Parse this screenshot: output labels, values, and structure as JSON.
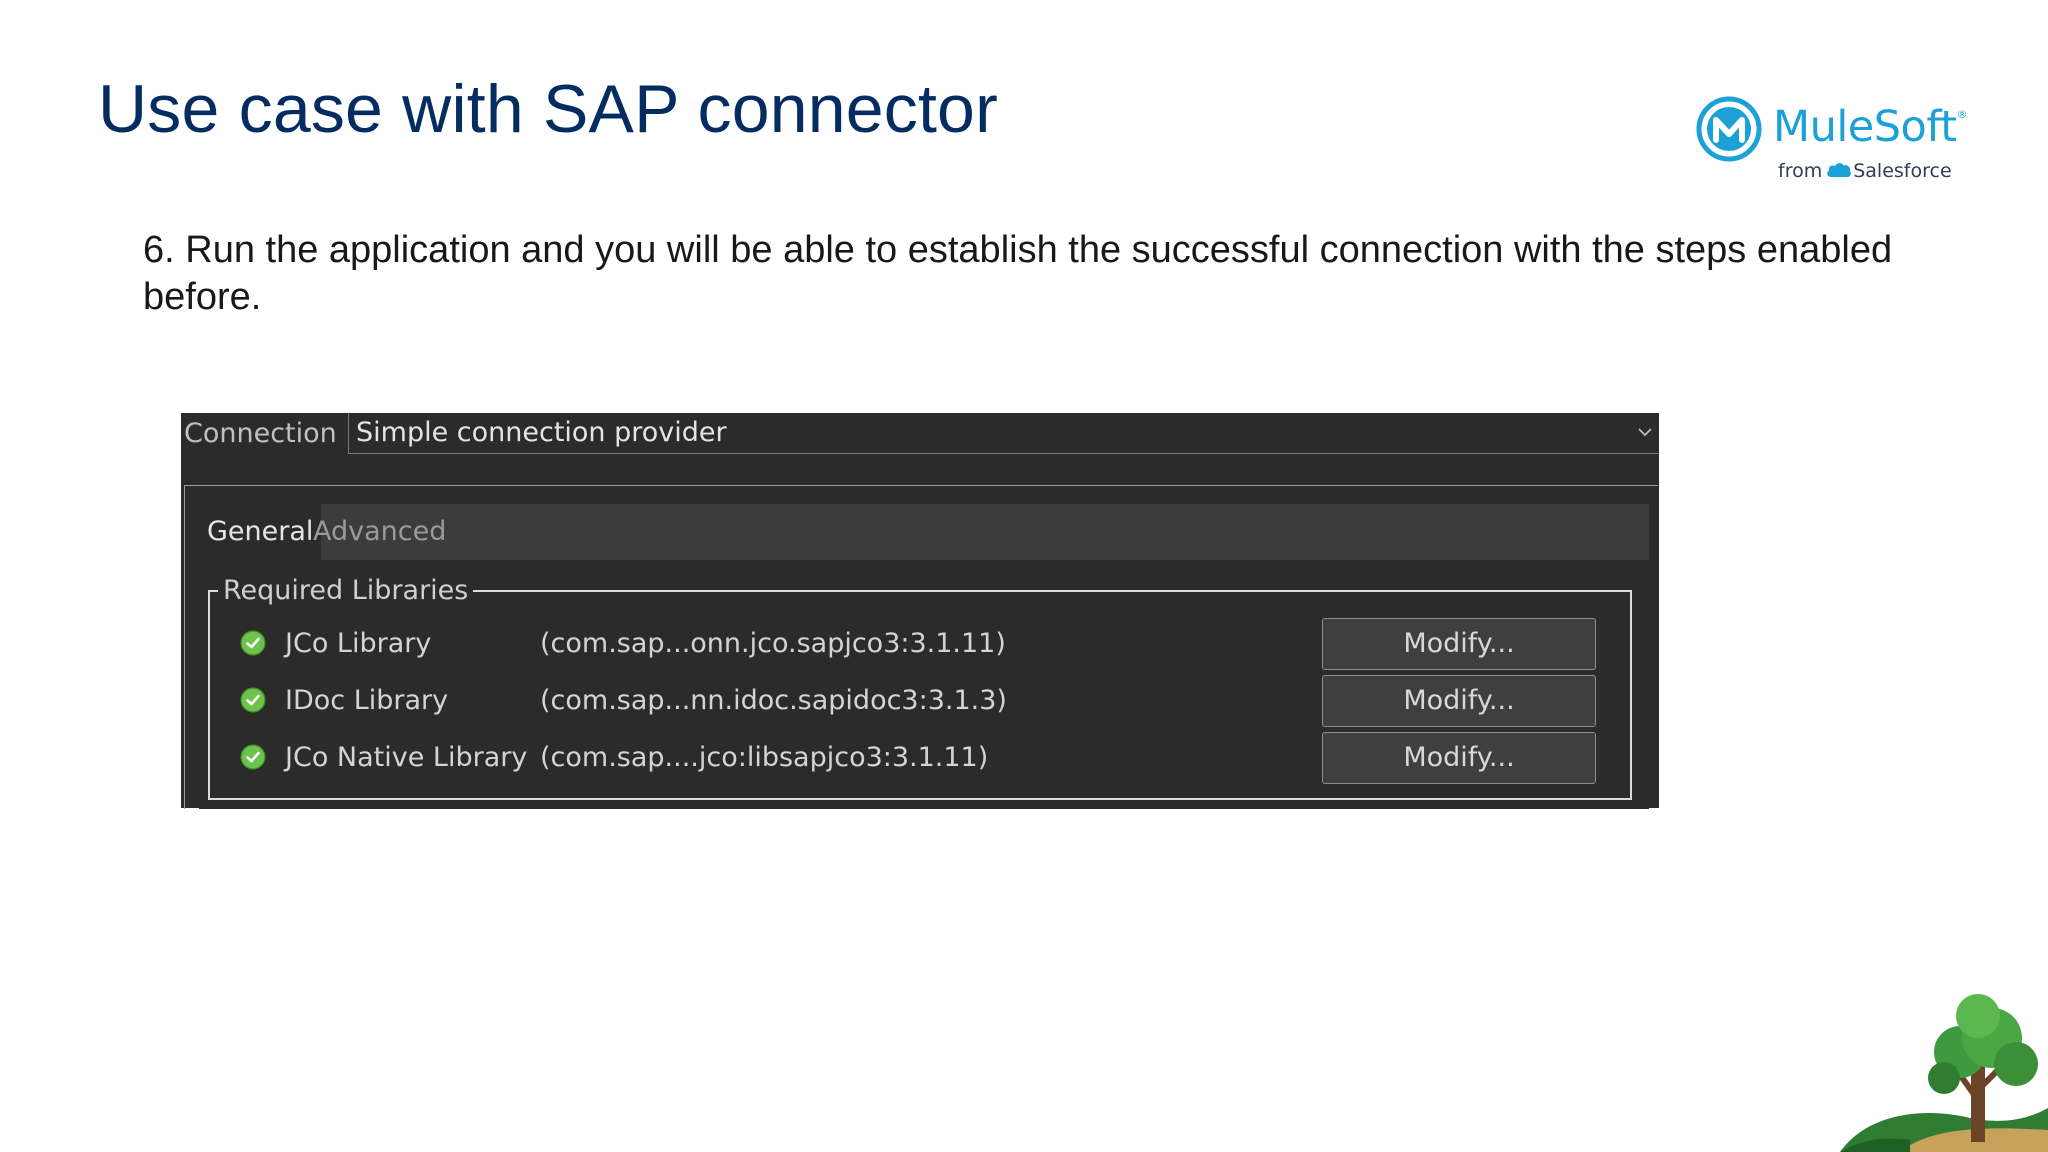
{
  "slide": {
    "title": "Use case with SAP connector",
    "instruction": "6. Run the application and you will be able to establish the successful connection with the steps enabled before."
  },
  "logo": {
    "word": "MuleSoft",
    "registered": "®",
    "from": "from",
    "company": "Salesforce",
    "brand_color": "#1ba1d8"
  },
  "panel": {
    "connection_label": "Connection",
    "connection_value": "Simple connection provider",
    "tabs": [
      {
        "label": "General",
        "active": true
      },
      {
        "label": "Advanced",
        "active": false
      }
    ],
    "group_label": "Required Libraries",
    "libraries": [
      {
        "name": "JCo Library",
        "coordinates": "(com.sap...onn.jco.sapjco3:3.1.11)",
        "status": "ok",
        "button": "Modify..."
      },
      {
        "name": "IDoc Library",
        "coordinates": "(com.sap...nn.idoc.sapidoc3:3.1.3)",
        "status": "ok",
        "button": "Modify..."
      },
      {
        "name": "JCo Native Library",
        "coordinates": "(com.sap....jco:libsapjco3:3.1.11)",
        "status": "ok",
        "button": "Modify..."
      }
    ],
    "status_color": "#6cc24a"
  }
}
